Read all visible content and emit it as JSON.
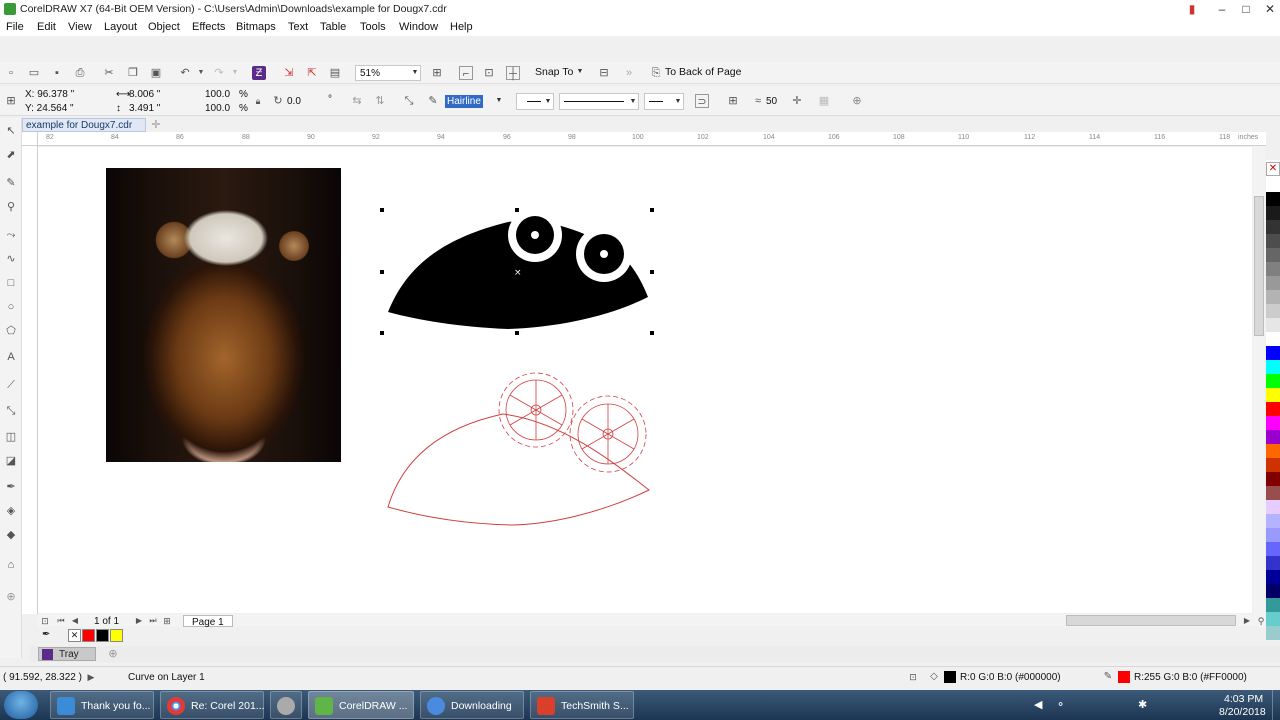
{
  "window": {
    "title": "CorelDRAW X7 (64-Bit OEM Version) - C:\\Users\\Admin\\Downloads\\example for Dougx7.cdr"
  },
  "menu": [
    "File",
    "Edit",
    "View",
    "Layout",
    "Object",
    "Effects",
    "Bitmaps",
    "Text",
    "Table",
    "Tools",
    "Window",
    "Help"
  ],
  "toolbar": {
    "zoom": "51%",
    "snap_to": "Snap To",
    "to_back": "To Back of Page"
  },
  "props": {
    "x": "X: 96.378 \"",
    "y": "Y: 24.564 \"",
    "w": "8.006 \"",
    "h": "3.491 \"",
    "sx": "100.0",
    "sy": "100.0",
    "pct": "%",
    "angle": "0.0",
    "deg": "°",
    "outline_width": "Hairline",
    "smooth": "50"
  },
  "document_tab": "example for Dougx7.cdr",
  "ruler": {
    "top": [
      "82",
      "84",
      "86",
      "88",
      "90",
      "92",
      "94",
      "96",
      "98",
      "100",
      "102",
      "104",
      "106",
      "108",
      "110",
      "112",
      "114",
      "116",
      "118"
    ],
    "unit": "inches"
  },
  "page_nav": {
    "count": "1 of 1",
    "page": "Page 1"
  },
  "tray": {
    "label": "Tray"
  },
  "status": {
    "coords": "( 91.592, 28.322 )",
    "object": "Curve on Layer 1",
    "fill": "R:0 G:0 B:0 (#000000)",
    "outline": "R:255 G:0 B:0 (#FF0000)"
  },
  "taskbar": {
    "items": [
      "Thank you fo...",
      "Re: Corel 201...",
      "CorelDRAW ...",
      "Downloading",
      "TechSmith S..."
    ],
    "time": "4:03 PM",
    "date": "8/20/2018"
  },
  "colors": {
    "accent": "#316ac5",
    "outline_red": "#d04040"
  },
  "palette": [
    "#ffffff",
    "#000000",
    "#1a1a1a",
    "#333333",
    "#4d4d4d",
    "#666666",
    "#808080",
    "#999999",
    "#b3b3b3",
    "#cccccc",
    "#e6e6e6",
    "#ffffff",
    "#0000ff",
    "#00ffff",
    "#00ff00",
    "#ffff00",
    "#ff0000",
    "#ff00ff",
    "#9900cc",
    "#ff6600",
    "#cc3300",
    "#800000",
    "#994d4d",
    "#e6ccff",
    "#b3b3ff",
    "#9999ff",
    "#6666ff",
    "#3333cc",
    "#000099",
    "#000066",
    "#339999",
    "#66cccc",
    "#99cccc"
  ]
}
